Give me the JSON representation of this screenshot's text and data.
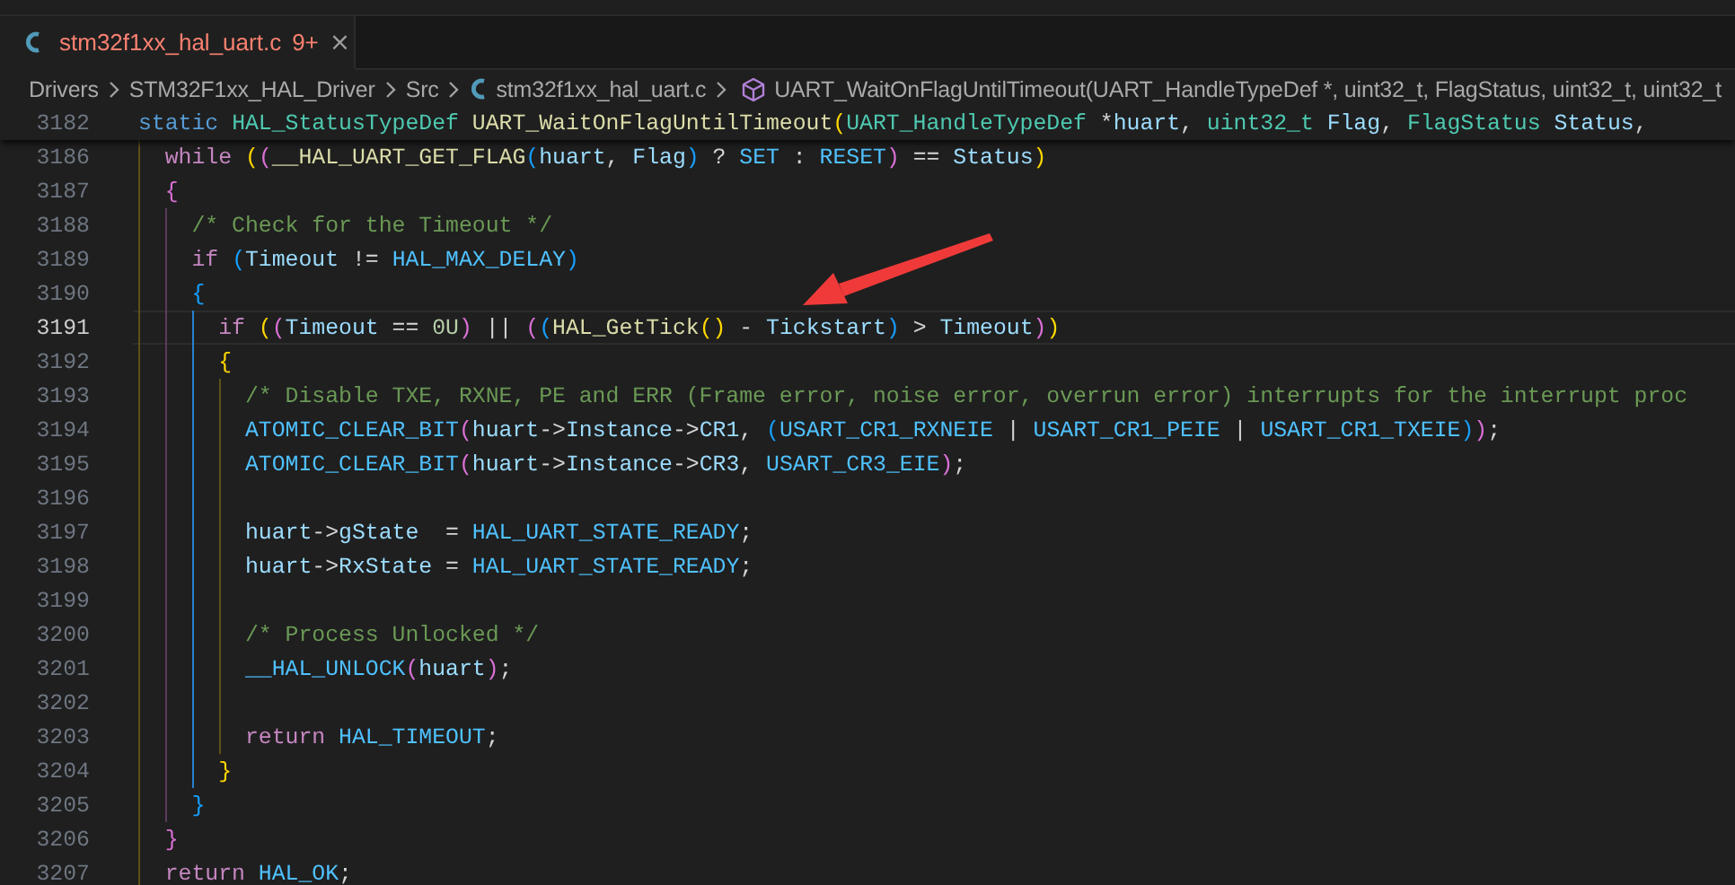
{
  "tabs": [
    {
      "label": "stm32f1xx_hal_uart.c",
      "problems": "9+",
      "selected": true,
      "errors": true,
      "close": "×"
    }
  ],
  "breadcrumbs": [
    {
      "kind": "folder",
      "text": "Drivers"
    },
    {
      "kind": "folder",
      "text": "STM32F1xx_HAL_Driver"
    },
    {
      "kind": "folder",
      "text": "Src"
    },
    {
      "kind": "file",
      "text": "stm32f1xx_hal_uart.c"
    },
    {
      "kind": "symbol",
      "text": "UART_WaitOnFlagUntilTimeout(UART_HandleTypeDef *, uint32_t, FlagStatus, uint32_t, uint32_t"
    }
  ],
  "sticky_line": {
    "number": "3182",
    "current": false,
    "tokens": [
      {
        "text": "static ",
        "kind": "kw"
      },
      {
        "text": "HAL_StatusTypeDef ",
        "kind": "type"
      },
      {
        "text": "UART_WaitOnFlagUntilTimeout",
        "kind": "fn"
      },
      {
        "text": "(",
        "kind": "b0"
      },
      {
        "text": "UART_HandleTypeDef",
        "kind": "type"
      },
      {
        "text": " *",
        "kind": "plain"
      },
      {
        "text": "huart",
        "kind": "var"
      },
      {
        "text": ", ",
        "kind": "plain"
      },
      {
        "text": "uint32_t ",
        "kind": "type"
      },
      {
        "text": "Flag",
        "kind": "var"
      },
      {
        "text": ", ",
        "kind": "plain"
      },
      {
        "text": "FlagStatus ",
        "kind": "type"
      },
      {
        "text": "Status",
        "kind": "var"
      },
      {
        "text": ",",
        "kind": "plain"
      }
    ]
  },
  "lines": [
    {
      "number": "3186",
      "current": false,
      "tokens": [
        {
          "text": "  while ",
          "kind": "ctl"
        },
        {
          "text": "(",
          "kind": "b0"
        },
        {
          "text": "(",
          "kind": "b1"
        },
        {
          "text": "__HAL_UART_GET_FLAG",
          "kind": "fn"
        },
        {
          "text": "(",
          "kind": "b2"
        },
        {
          "text": "huart",
          "kind": "var"
        },
        {
          "text": ", ",
          "kind": "plain"
        },
        {
          "text": "Flag",
          "kind": "var"
        },
        {
          "text": ")",
          "kind": "b2"
        },
        {
          "text": " ? ",
          "kind": "plain"
        },
        {
          "text": "SET",
          "kind": "mac"
        },
        {
          "text": " : ",
          "kind": "plain"
        },
        {
          "text": "RESET",
          "kind": "mac"
        },
        {
          "text": ")",
          "kind": "b1"
        },
        {
          "text": " == ",
          "kind": "plain"
        },
        {
          "text": "Status",
          "kind": "var"
        },
        {
          "text": ")",
          "kind": "b0"
        }
      ]
    },
    {
      "number": "3187",
      "current": false,
      "tokens": [
        {
          "text": "  {",
          "kind": "b1"
        }
      ]
    },
    {
      "number": "3188",
      "current": false,
      "tokens": [
        {
          "text": "    /* Check for the Timeout */",
          "kind": "cmt"
        }
      ]
    },
    {
      "number": "3189",
      "current": false,
      "tokens": [
        {
          "text": "    if ",
          "kind": "ctl"
        },
        {
          "text": "(",
          "kind": "b2"
        },
        {
          "text": "Timeout",
          "kind": "var"
        },
        {
          "text": " != ",
          "kind": "plain"
        },
        {
          "text": "HAL_MAX_DELAY",
          "kind": "mac"
        },
        {
          "text": ")",
          "kind": "b2"
        }
      ]
    },
    {
      "number": "3190",
      "current": false,
      "tokens": [
        {
          "text": "    {",
          "kind": "b2"
        }
      ]
    },
    {
      "number": "3191",
      "current": true,
      "tokens": [
        {
          "text": "      if ",
          "kind": "ctl"
        },
        {
          "text": "(",
          "kind": "b0"
        },
        {
          "text": "(",
          "kind": "b1"
        },
        {
          "text": "Timeout",
          "kind": "var"
        },
        {
          "text": " == ",
          "kind": "plain"
        },
        {
          "text": "0U",
          "kind": "num"
        },
        {
          "text": ")",
          "kind": "b1"
        },
        {
          "text": " || ",
          "kind": "plain"
        },
        {
          "text": "(",
          "kind": "b1"
        },
        {
          "text": "(",
          "kind": "b2"
        },
        {
          "text": "HAL_GetTick",
          "kind": "fn"
        },
        {
          "text": "()",
          "kind": "b0"
        },
        {
          "text": " - ",
          "kind": "plain"
        },
        {
          "text": "Tickstart",
          "kind": "var"
        },
        {
          "text": ")",
          "kind": "b2"
        },
        {
          "text": " > ",
          "kind": "plain"
        },
        {
          "text": "Timeout",
          "kind": "var"
        },
        {
          "text": ")",
          "kind": "b1"
        },
        {
          "text": ")",
          "kind": "b0"
        }
      ]
    },
    {
      "number": "3192",
      "current": false,
      "tokens": [
        {
          "text": "      {",
          "kind": "b0"
        }
      ]
    },
    {
      "number": "3193",
      "current": false,
      "tokens": [
        {
          "text": "        /* Disable TXE, RXNE, PE and ERR (Frame error, noise error, overrun error) interrupts for the interrupt proc",
          "kind": "cmt"
        }
      ]
    },
    {
      "number": "3194",
      "current": false,
      "tokens": [
        {
          "text": "        ATOMIC_CLEAR_BIT",
          "kind": "mac"
        },
        {
          "text": "(",
          "kind": "b1"
        },
        {
          "text": "huart",
          "kind": "var"
        },
        {
          "text": "->",
          "kind": "plain"
        },
        {
          "text": "Instance",
          "kind": "var"
        },
        {
          "text": "->",
          "kind": "plain"
        },
        {
          "text": "CR1",
          "kind": "var"
        },
        {
          "text": ", ",
          "kind": "plain"
        },
        {
          "text": "(",
          "kind": "b2"
        },
        {
          "text": "USART_CR1_RXNEIE",
          "kind": "mac"
        },
        {
          "text": " | ",
          "kind": "plain"
        },
        {
          "text": "USART_CR1_PEIE",
          "kind": "mac"
        },
        {
          "text": " | ",
          "kind": "plain"
        },
        {
          "text": "USART_CR1_TXEIE",
          "kind": "mac"
        },
        {
          "text": ")",
          "kind": "b2"
        },
        {
          "text": ")",
          "kind": "b1"
        },
        {
          "text": ";",
          "kind": "plain"
        }
      ]
    },
    {
      "number": "3195",
      "current": false,
      "tokens": [
        {
          "text": "        ATOMIC_CLEAR_BIT",
          "kind": "mac"
        },
        {
          "text": "(",
          "kind": "b1"
        },
        {
          "text": "huart",
          "kind": "var"
        },
        {
          "text": "->",
          "kind": "plain"
        },
        {
          "text": "Instance",
          "kind": "var"
        },
        {
          "text": "->",
          "kind": "plain"
        },
        {
          "text": "CR3",
          "kind": "var"
        },
        {
          "text": ", ",
          "kind": "plain"
        },
        {
          "text": "USART_CR3_EIE",
          "kind": "mac"
        },
        {
          "text": ")",
          "kind": "b1"
        },
        {
          "text": ";",
          "kind": "plain"
        }
      ]
    },
    {
      "number": "3196",
      "current": false
    },
    {
      "number": "3197",
      "current": false,
      "tokens": [
        {
          "text": "        huart",
          "kind": "var"
        },
        {
          "text": "->",
          "kind": "plain"
        },
        {
          "text": "gState",
          "kind": "var"
        },
        {
          "text": "  = ",
          "kind": "plain"
        },
        {
          "text": "HAL_UART_STATE_READY",
          "kind": "mac"
        },
        {
          "text": ";",
          "kind": "plain"
        }
      ]
    },
    {
      "number": "3198",
      "current": false,
      "tokens": [
        {
          "text": "        huart",
          "kind": "var"
        },
        {
          "text": "->",
          "kind": "plain"
        },
        {
          "text": "RxState",
          "kind": "var"
        },
        {
          "text": " = ",
          "kind": "plain"
        },
        {
          "text": "HAL_UART_STATE_READY",
          "kind": "mac"
        },
        {
          "text": ";",
          "kind": "plain"
        }
      ]
    },
    {
      "number": "3199",
      "current": false
    },
    {
      "number": "3200",
      "current": false,
      "tokens": [
        {
          "text": "        /* Process Unlocked */",
          "kind": "cmt"
        }
      ]
    },
    {
      "number": "3201",
      "current": false,
      "tokens": [
        {
          "text": "        __HAL_UNLOCK",
          "kind": "mac"
        },
        {
          "text": "(",
          "kind": "b1"
        },
        {
          "text": "huart",
          "kind": "var"
        },
        {
          "text": ")",
          "kind": "b1"
        },
        {
          "text": ";",
          "kind": "plain"
        }
      ]
    },
    {
      "number": "3202",
      "current": false
    },
    {
      "number": "3203",
      "current": false,
      "tokens": [
        {
          "text": "        return ",
          "kind": "ctl"
        },
        {
          "text": "HAL_TIMEOUT",
          "kind": "mac"
        },
        {
          "text": ";",
          "kind": "plain"
        }
      ]
    },
    {
      "number": "3204",
      "current": false,
      "tokens": [
        {
          "text": "      }",
          "kind": "b0"
        }
      ]
    },
    {
      "number": "3205",
      "current": false,
      "tokens": [
        {
          "text": "    }",
          "kind": "b2"
        }
      ]
    },
    {
      "number": "3206",
      "current": false,
      "tokens": [
        {
          "text": "  }",
          "kind": "b1"
        }
      ]
    },
    {
      "number": "3207",
      "current": false,
      "tokens": [
        {
          "text": "  return ",
          "kind": "ctl"
        },
        {
          "text": "HAL_OK",
          "kind": "mac"
        },
        {
          "text": ";",
          "kind": "plain"
        }
      ]
    }
  ]
}
